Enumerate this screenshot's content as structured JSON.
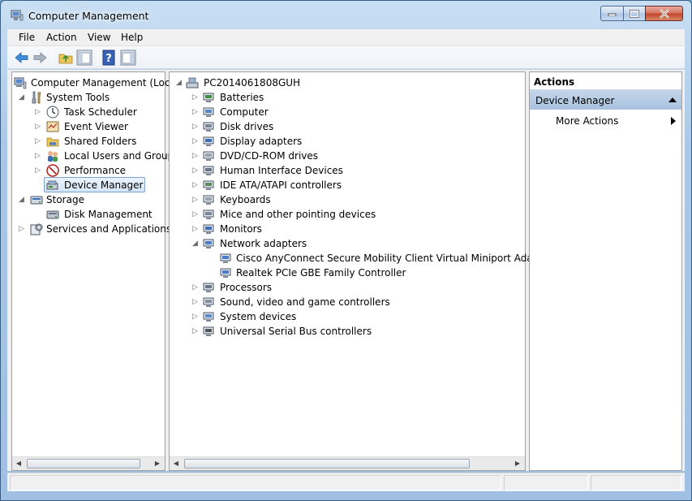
{
  "window": {
    "title": "Computer Management"
  },
  "menu": [
    "File",
    "Action",
    "View",
    "Help"
  ],
  "toolbar": {
    "icons": [
      "back-arrow-icon",
      "forward-arrow-icon",
      "up-folder-icon",
      "show-hide-tree-icon",
      "help-icon",
      "show-hide-action-pane-icon"
    ]
  },
  "tree": {
    "root": "Computer Management (Local",
    "system_tools": "System Tools",
    "task_scheduler": "Task Scheduler",
    "event_viewer": "Event Viewer",
    "shared_folders": "Shared Folders",
    "local_users": "Local Users and Groups",
    "performance": "Performance",
    "device_manager": "Device Manager",
    "storage": "Storage",
    "disk_management": "Disk Management",
    "services": "Services and Applications"
  },
  "devices": {
    "computer_name": "PC2014061808GUH",
    "categories": [
      "Batteries",
      "Computer",
      "Disk drives",
      "Display adapters",
      "DVD/CD-ROM drives",
      "Human Interface Devices",
      "IDE ATA/ATAPI controllers",
      "Keyboards",
      "Mice and other pointing devices",
      "Monitors",
      "Network adapters",
      "Processors",
      "Sound, video and game controllers",
      "System devices",
      "Universal Serial Bus controllers"
    ],
    "network_adapters": [
      "Cisco AnyConnect Secure Mobility Client Virtual Miniport Adapter fo",
      "Realtek PCIe GBE Family Controller"
    ]
  },
  "actions": {
    "header": "Actions",
    "group": "Device Manager",
    "more": "More Actions"
  },
  "colors": {
    "titlebar": "#a9c7e6",
    "selection": "#d6e6f8",
    "actions_group": "#b7cce6"
  }
}
